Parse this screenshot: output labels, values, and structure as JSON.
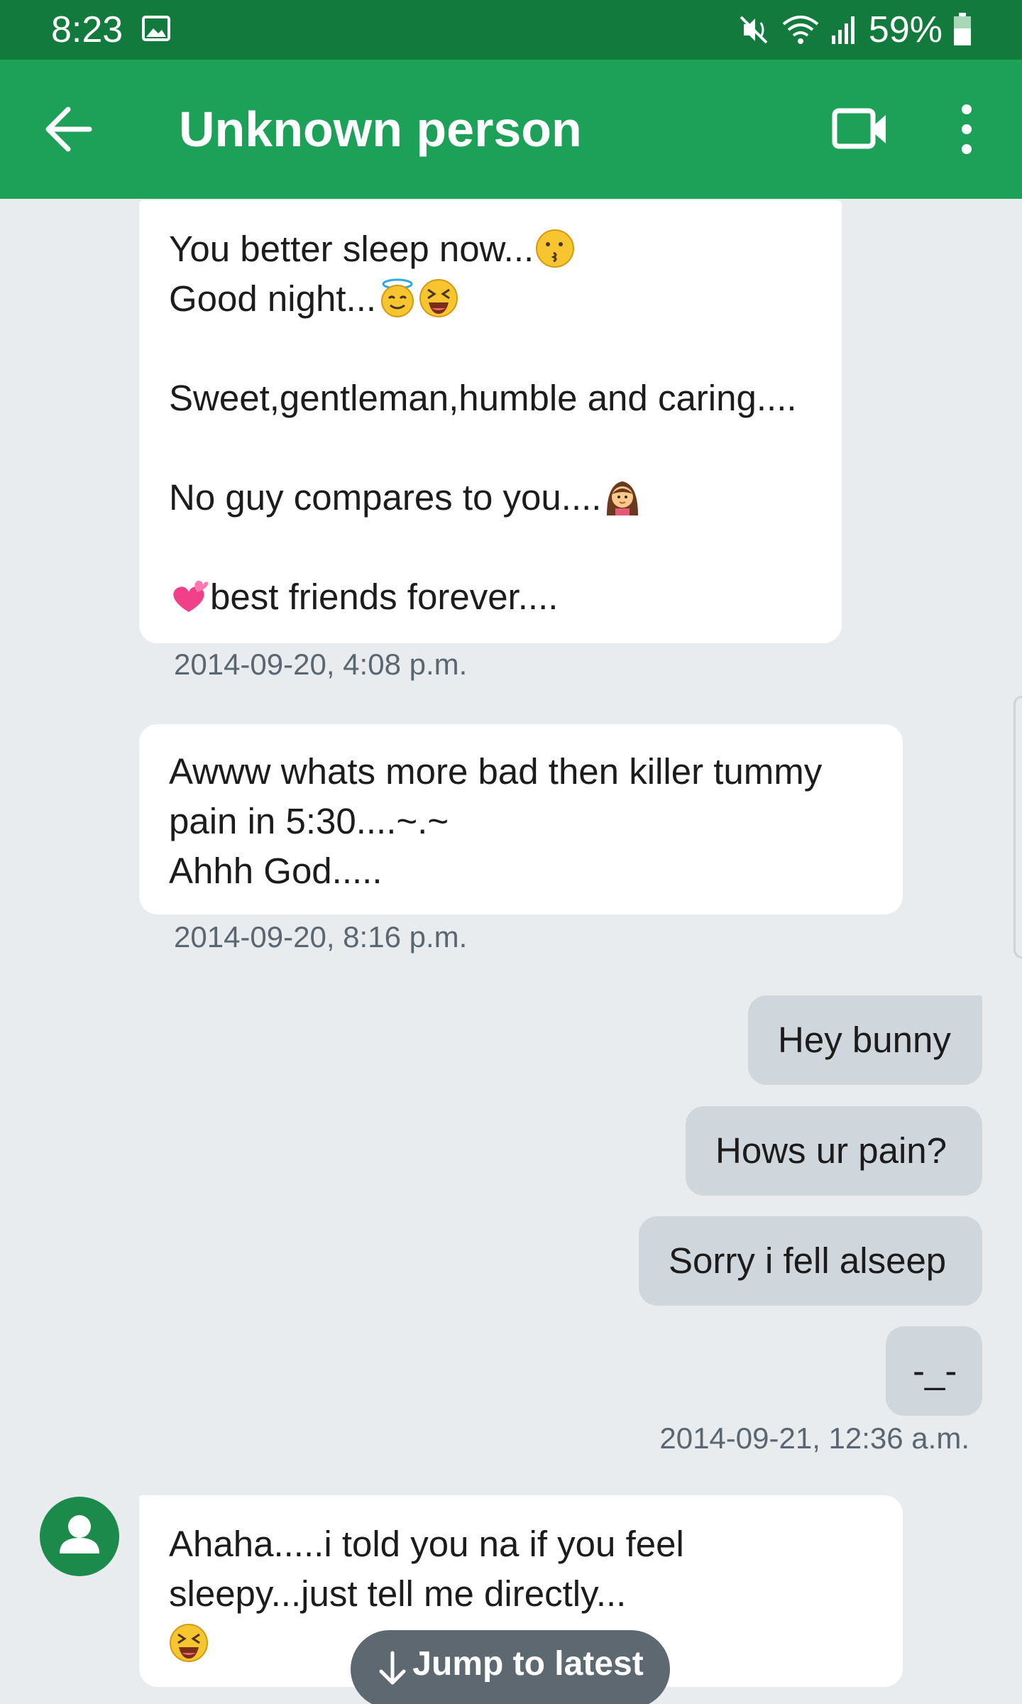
{
  "status_bar": {
    "time": "8:23",
    "battery": "59%"
  },
  "app_bar": {
    "title": "Unknown person"
  },
  "messages": [
    {
      "direction": "incoming",
      "lines": [
        "You better sleep now...",
        "Good night...",
        "",
        "Sweet,gentleman,humble and caring....",
        "",
        "No guy compares to you....",
        "",
        "best friends forever...."
      ],
      "timestamp": "2014-09-20, 4:08 p.m."
    },
    {
      "direction": "incoming",
      "lines": [
        "Awww whats more bad then killer tummy",
        "pain in 5:30....~.~",
        "Ahhh God....."
      ],
      "timestamp": "2014-09-20, 8:16 p.m."
    },
    {
      "direction": "outgoing",
      "text": "Hey bunny"
    },
    {
      "direction": "outgoing",
      "text": "Hows ur pain?"
    },
    {
      "direction": "outgoing",
      "text": "Sorry i fell alseep"
    },
    {
      "direction": "outgoing",
      "text": "-_-",
      "timestamp": "2014-09-21, 12:36 a.m."
    },
    {
      "direction": "incoming",
      "lines": [
        "Ahaha.....i told you na if you feel",
        "sleepy...just tell me directly..."
      ]
    }
  ],
  "jump_button": {
    "label": "Jump to latest"
  },
  "colors": {
    "status_bar": "#137a3e",
    "app_bar": "#1da057",
    "background": "#e8ecef",
    "incoming_bubble": "#ffffff",
    "outgoing_bubble": "#cfd6dc",
    "jump_button": "#5d6870"
  },
  "icons": [
    "image-icon",
    "mute-icon",
    "wifi-icon",
    "signal-icon",
    "battery-icon",
    "back-arrow-icon",
    "video-call-icon",
    "more-vert-icon",
    "avatar-person-icon",
    "arrow-down-icon",
    "kissing-face-emoji",
    "halo-face-emoji",
    "squinting-face-emoji",
    "girl-emoji",
    "two-hearts-emoji"
  ]
}
